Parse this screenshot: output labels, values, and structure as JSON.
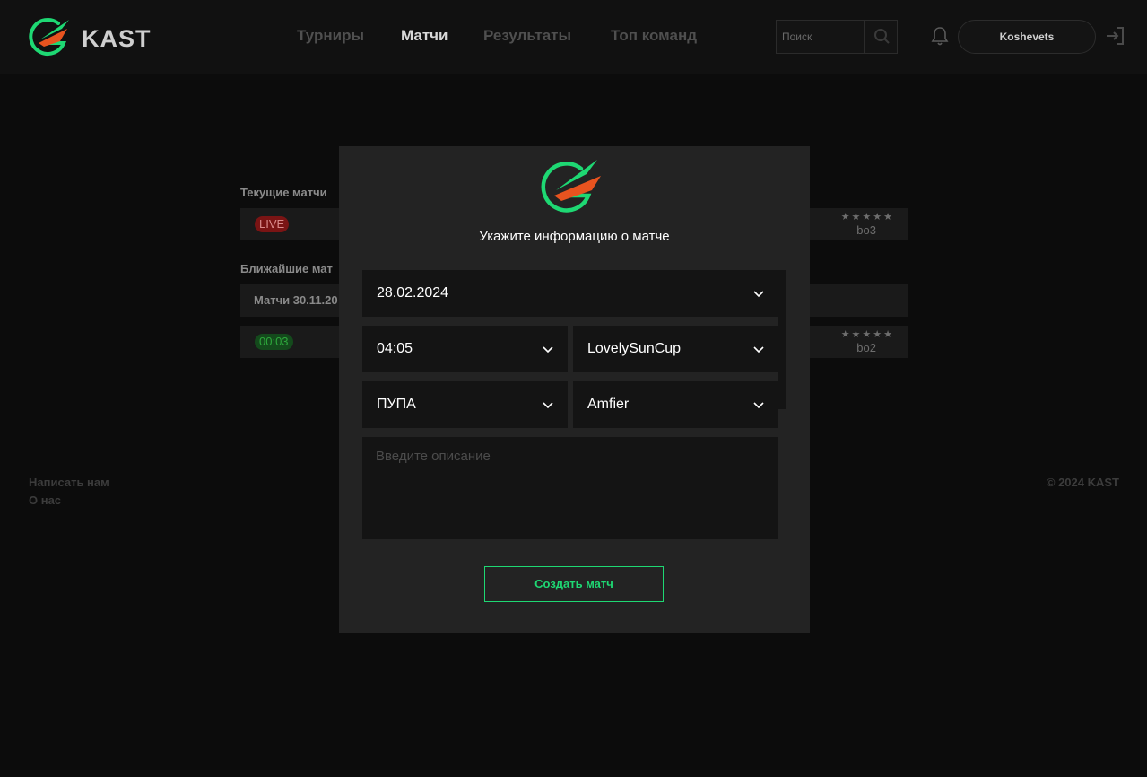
{
  "brand": {
    "name": "KAST"
  },
  "nav": {
    "items": [
      {
        "label": "Турниры",
        "active": false
      },
      {
        "label": "Матчи",
        "active": true
      },
      {
        "label": "Результаты",
        "active": false
      },
      {
        "label": "Топ команд",
        "active": false
      }
    ]
  },
  "search": {
    "placeholder": "Поиск"
  },
  "user": {
    "name": "Koshevets"
  },
  "page": {
    "current_title": "Текущие матчи",
    "current_match": {
      "status": "LIVE",
      "format": "bo3",
      "stars": "★★★★★"
    },
    "upcoming_title": "Ближайшие мат",
    "upcoming_date_label": "Матчи 30.11.20",
    "upcoming_match": {
      "time": "00:03",
      "format": "bo2",
      "stars": "★★★★★"
    }
  },
  "footer": {
    "contact": "Написать нам",
    "about": "О нас",
    "copyright": "© 2024 KAST"
  },
  "modal": {
    "title": "Укажите информацию о матче",
    "date": "28.02.2024",
    "time": "04:05",
    "tournament": "LovelySunCup",
    "team1": "ПУПА",
    "team2": "Amfier",
    "description_placeholder": "Введите описание",
    "submit_label": "Создать матч"
  },
  "colors": {
    "accent_green": "#1ed873",
    "accent_orange": "#e8531f",
    "live_red": "#7a1414",
    "modal_bg": "#232323"
  }
}
